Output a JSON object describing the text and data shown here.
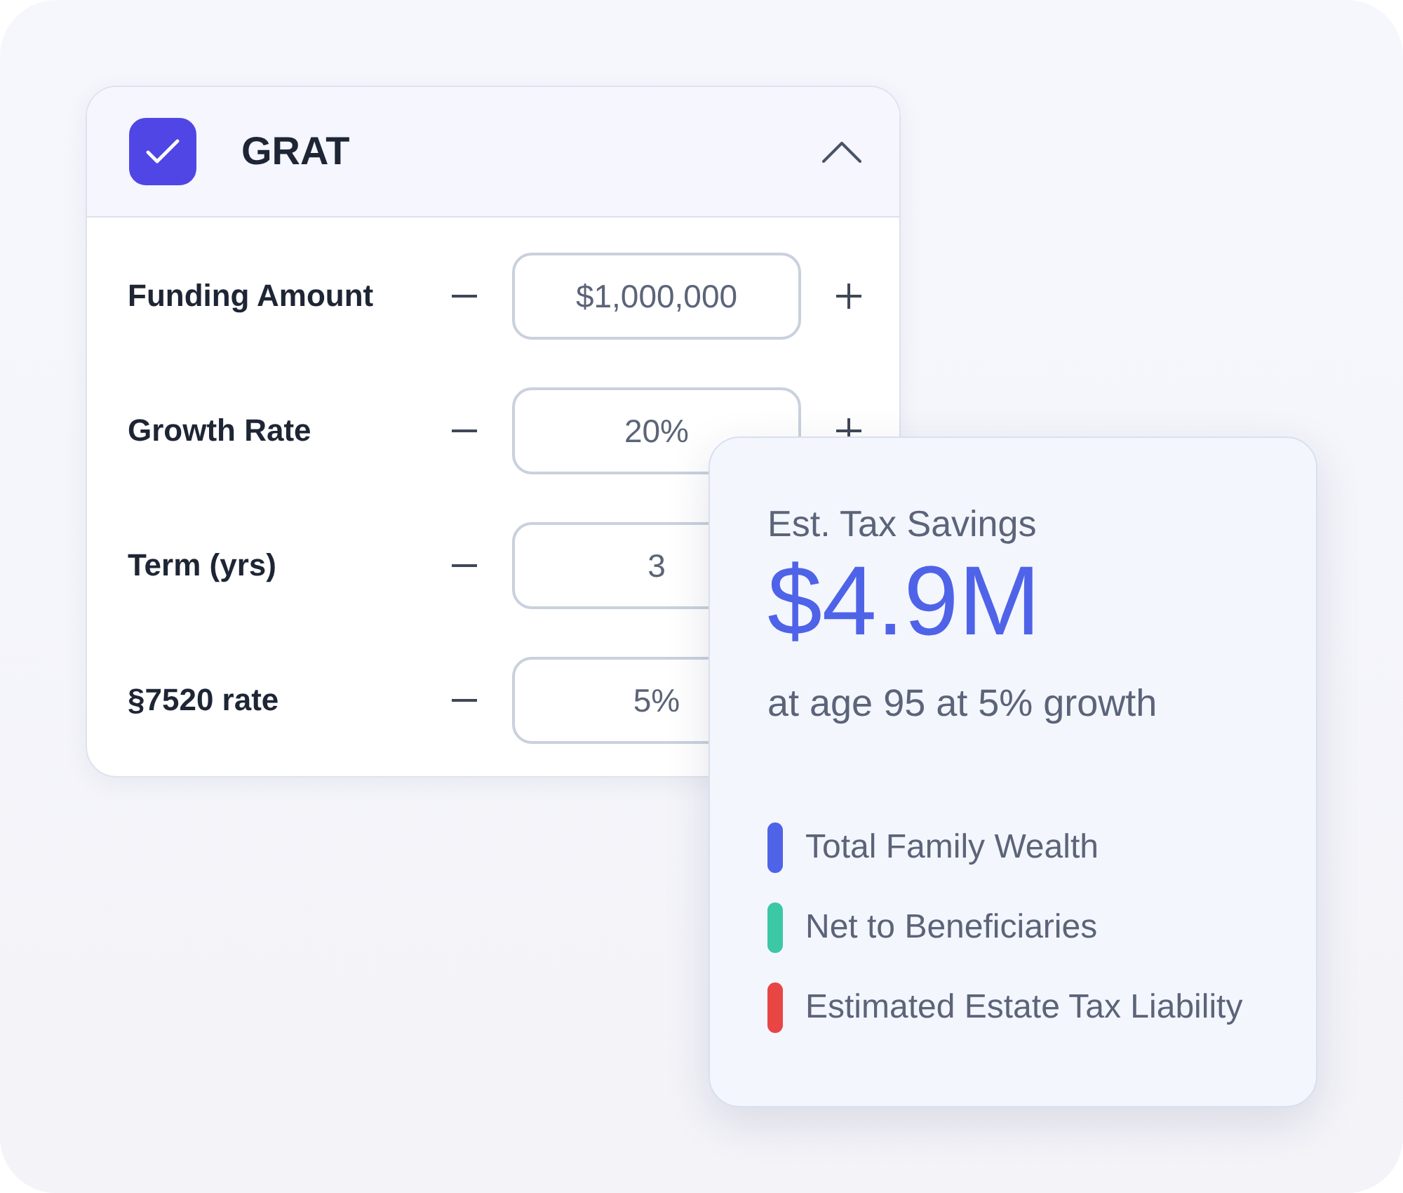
{
  "plan": {
    "title": "GRAT",
    "checked": true,
    "expanded": true
  },
  "fields": [
    {
      "label": "Funding Amount",
      "value": "$1,000,000"
    },
    {
      "label": "Growth Rate",
      "value": "20%"
    },
    {
      "label": "Term (yrs)",
      "value": "3"
    },
    {
      "label": "§7520 rate",
      "value": "5%"
    }
  ],
  "summary": {
    "title": "Est. Tax Savings",
    "amount": "$4.9M",
    "caption": "at age 95 at 5% growth",
    "legend": [
      {
        "label": "Total Family Wealth",
        "color": "#4f63e8"
      },
      {
        "label": "Net to Beneficiaries",
        "color": "#3cc7a5"
      },
      {
        "label": "Estimated Estate Tax Liability",
        "color": "#e84545"
      }
    ]
  }
}
